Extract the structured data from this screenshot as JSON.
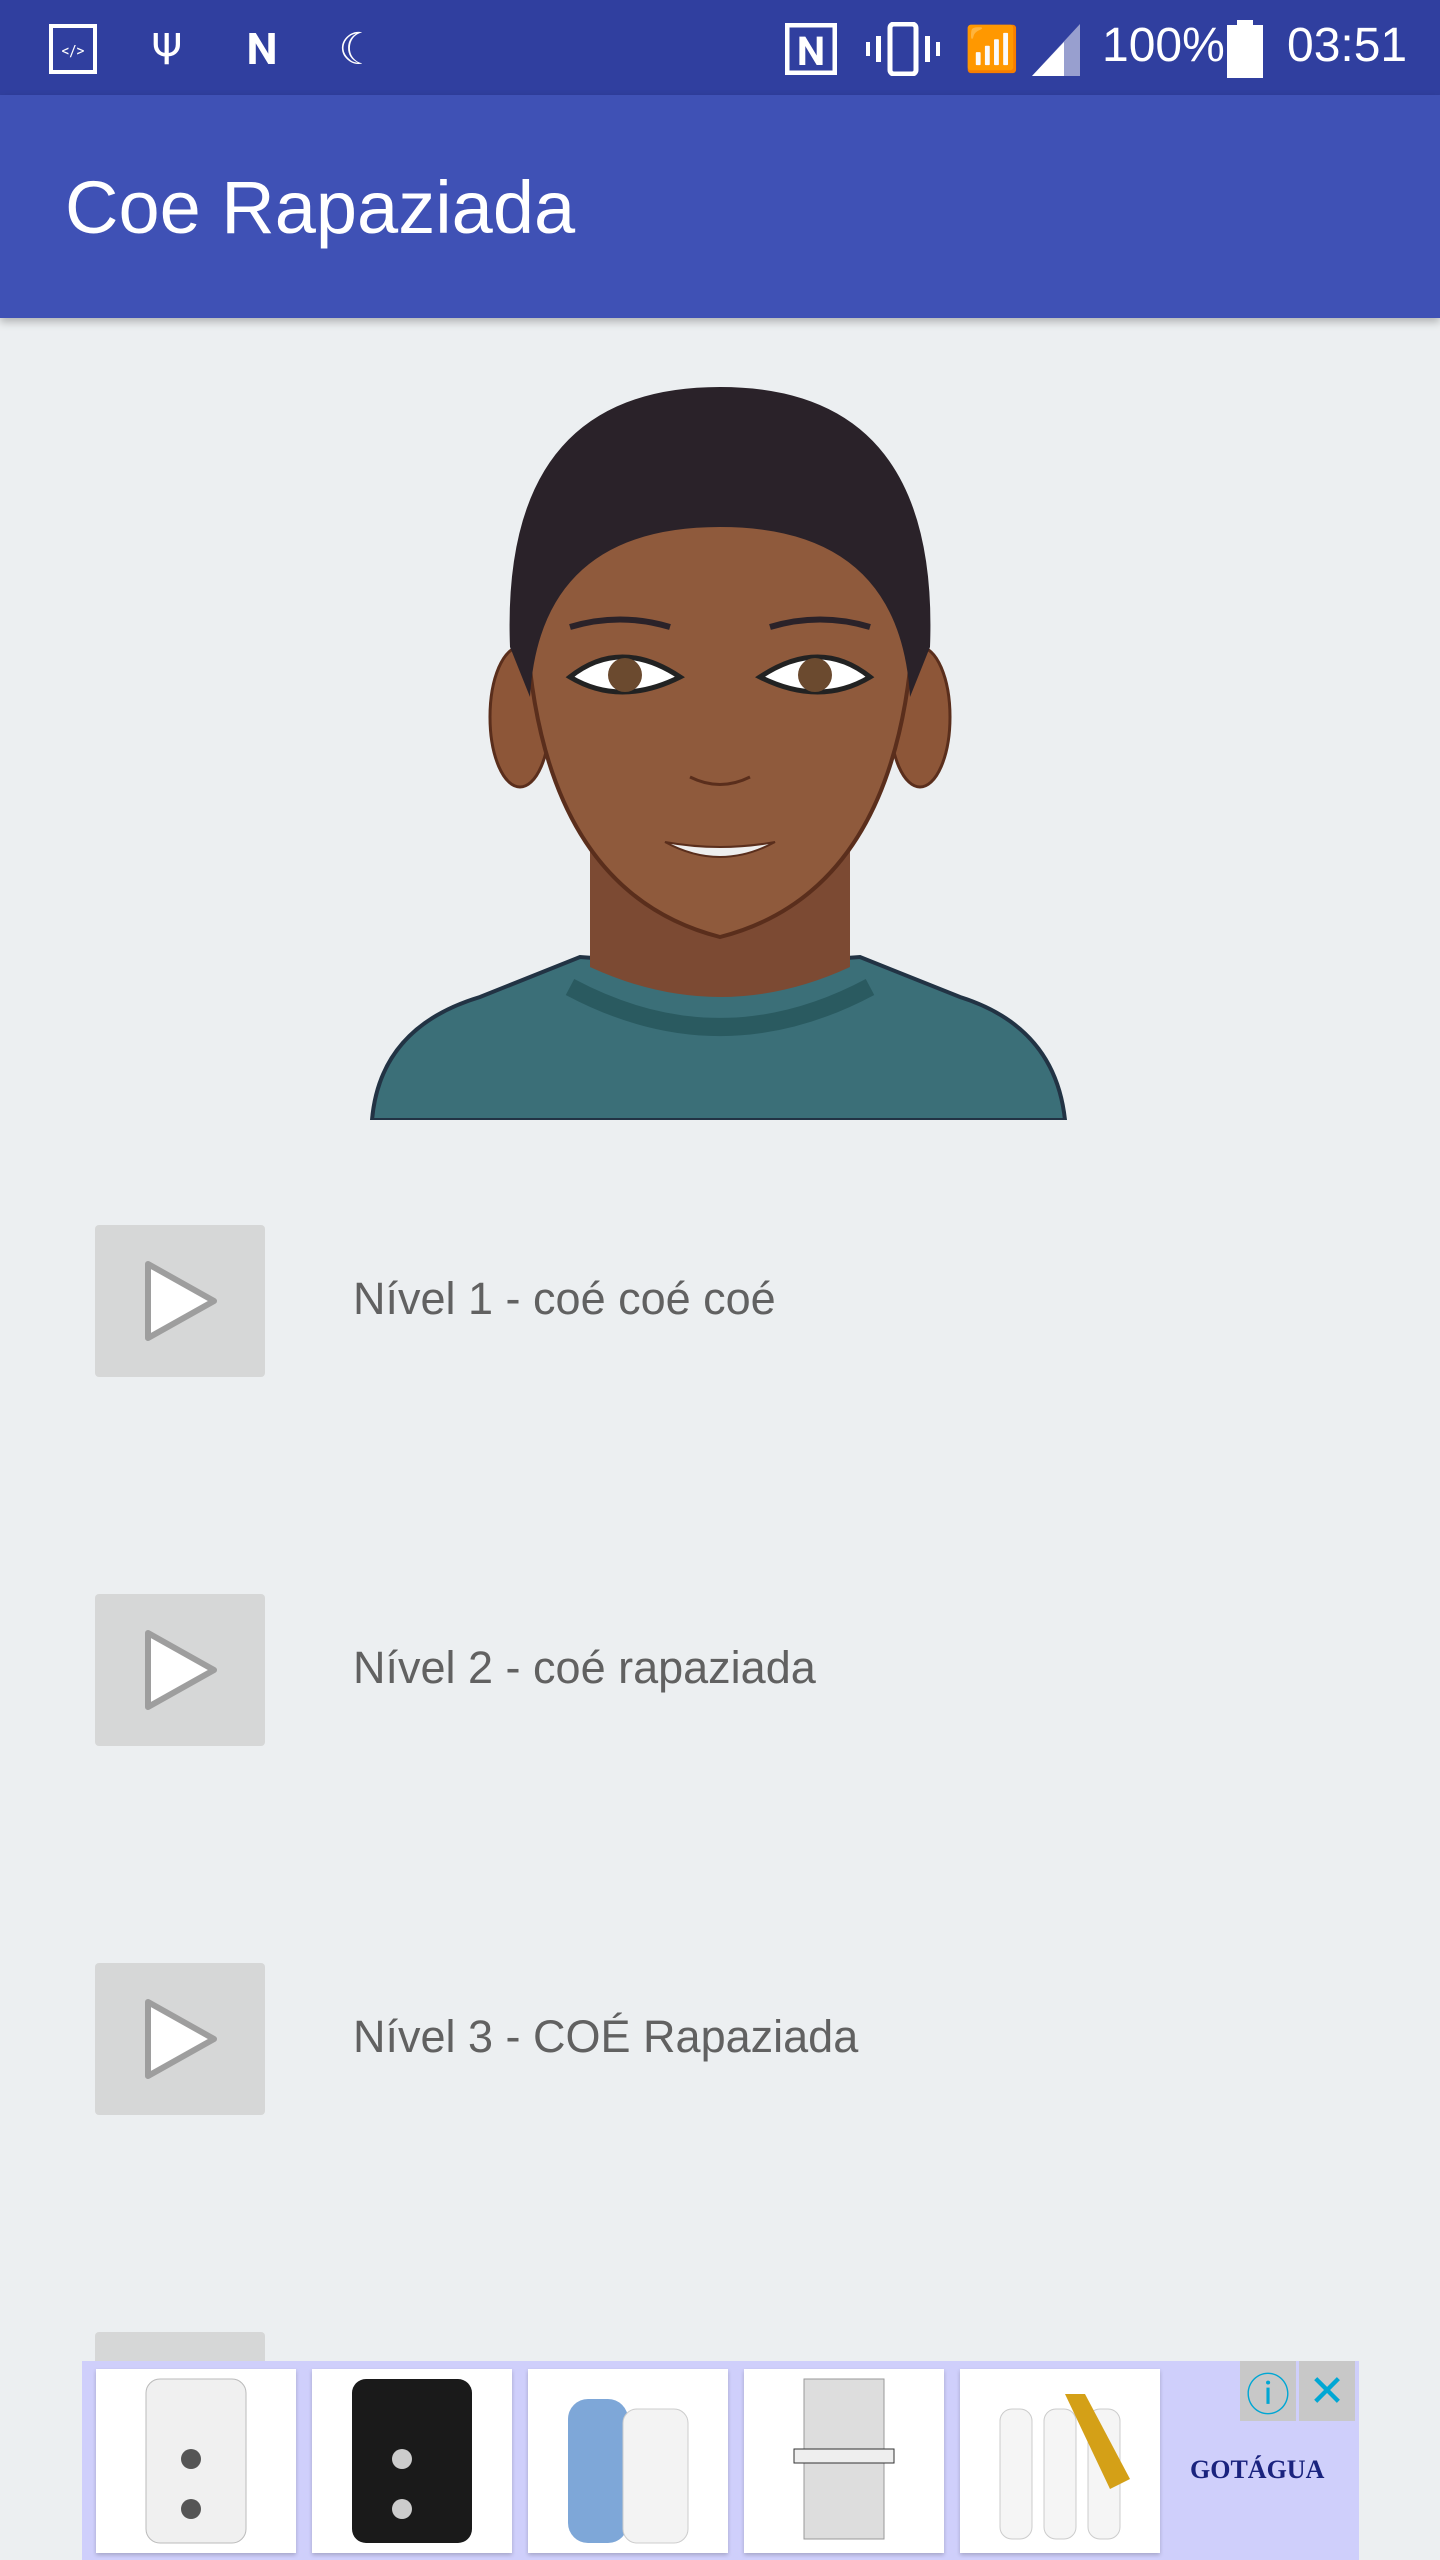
{
  "status_bar": {
    "battery": "100%",
    "time": "03:51",
    "icons": [
      "developer-icon",
      "usb-icon",
      "n-icon",
      "moon-icon",
      "nfc-icon",
      "vibrate-icon",
      "wifi-icon",
      "signal-icon",
      "battery-icon"
    ]
  },
  "app_bar": {
    "title": "Coe Rapaziada"
  },
  "levels": [
    {
      "label": "Nível 1 - coé coé coé"
    },
    {
      "label": "Nível 2 - coé rapaziada"
    },
    {
      "label": "Nível 3 - COÉ Rapaziada"
    },
    {
      "label": ""
    }
  ],
  "ad": {
    "brand": "GOTÁGUA",
    "info_icon": "info-icon",
    "close_icon": "close-icon"
  },
  "colors": {
    "status": "#303f9f",
    "primary": "#3f51b5",
    "background": "#eceff1"
  }
}
